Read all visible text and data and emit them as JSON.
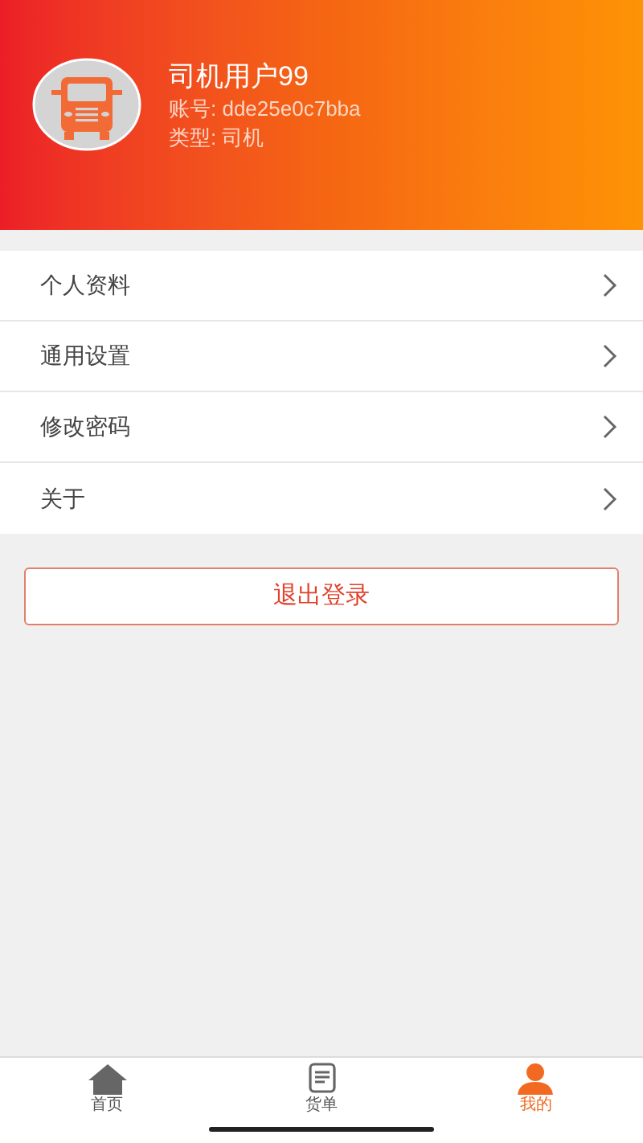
{
  "profile": {
    "name": "司机用户99",
    "account": "账号: dde25e0c7bba",
    "type": "类型: 司机"
  },
  "menu": [
    {
      "label": "个人资料"
    },
    {
      "label": "通用设置"
    },
    {
      "label": "修改密码"
    },
    {
      "label": "关于"
    }
  ],
  "logout_button": "退出登录",
  "tab_bar": [
    {
      "label": "首页",
      "kind": "home",
      "selected": false
    },
    {
      "label": "货单",
      "kind": "list",
      "selected": false
    },
    {
      "label": "我的",
      "kind": "user",
      "selected": true
    }
  ]
}
